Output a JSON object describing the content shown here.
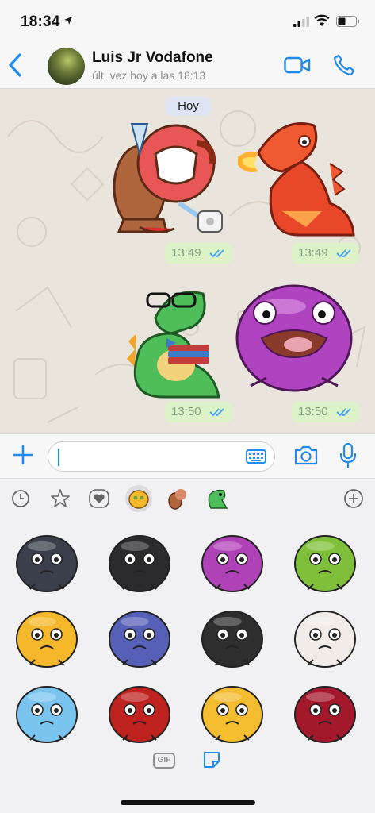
{
  "status_bar": {
    "time": "18:34"
  },
  "header": {
    "contact_name": "Luis Jr Vodafone",
    "last_seen": "últ. vez hoy a las 18:13"
  },
  "chat": {
    "date_label": "Hoy",
    "messages": [
      {
        "time": "13:49",
        "sticker": "tooth-monster-sticker"
      },
      {
        "time": "13:49",
        "sticker": "fire-dinosaur-sticker"
      },
      {
        "time": "13:50",
        "sticker": "nerd-dinosaur-sticker"
      },
      {
        "time": "13:50",
        "sticker": "purple-blob-sticker"
      }
    ]
  },
  "input": {
    "placeholder": ""
  },
  "stickers": {
    "gif_label": "GIF",
    "grid": [
      {
        "color": "#3a3f4b"
      },
      {
        "color": "#2b2b2e"
      },
      {
        "color": "#b042b8"
      },
      {
        "color": "#7fbf3a"
      },
      {
        "color": "#f5b82a"
      },
      {
        "color": "#5660b6"
      },
      {
        "color": "#2e2e2e"
      },
      {
        "color": "#f1ece8"
      },
      {
        "color": "#7ac4f0"
      },
      {
        "color": "#c0231f"
      },
      {
        "color": "#f4bc2f"
      },
      {
        "color": "#a3182b"
      }
    ]
  },
  "colors": {
    "accent": "#1f8bf1",
    "bubble": "#dcf3c8",
    "ticks": "#4aa3f0"
  }
}
